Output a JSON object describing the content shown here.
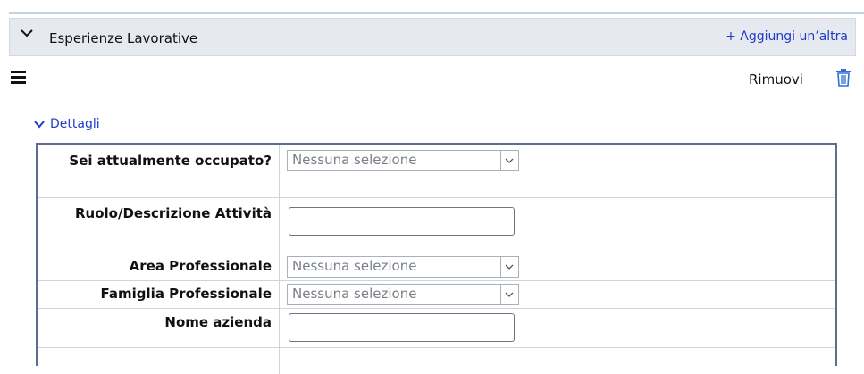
{
  "section": {
    "title": "Esperienze Lavorative",
    "add_label": "+ Aggiungi un’altra"
  },
  "entry": {
    "remove_label": "Rimuovi",
    "details_label": "Dettagli"
  },
  "icons": {
    "section_toggle": "chevron-down-icon",
    "drag_handle": "hamburger-menu-icon",
    "delete": "trash-icon",
    "details_toggle": "chevron-down-icon"
  },
  "colors": {
    "link": "#1f3bc7",
    "header_bg": "#e6e9ef",
    "form_border": "#5c6e8e",
    "trash": "#2f6fd6"
  },
  "fields": [
    {
      "label": "Sei attualmente occupato?",
      "type": "select",
      "value": "Nessuna selezione"
    },
    {
      "label": "Ruolo/Descrizione Attività",
      "type": "text",
      "value": ""
    },
    {
      "label": "Area Professionale",
      "type": "select",
      "value": "Nessuna selezione"
    },
    {
      "label": "Famiglia Professionale",
      "type": "select",
      "value": "Nessuna selezione"
    },
    {
      "label": "Nome azienda",
      "type": "text",
      "value": ""
    }
  ]
}
